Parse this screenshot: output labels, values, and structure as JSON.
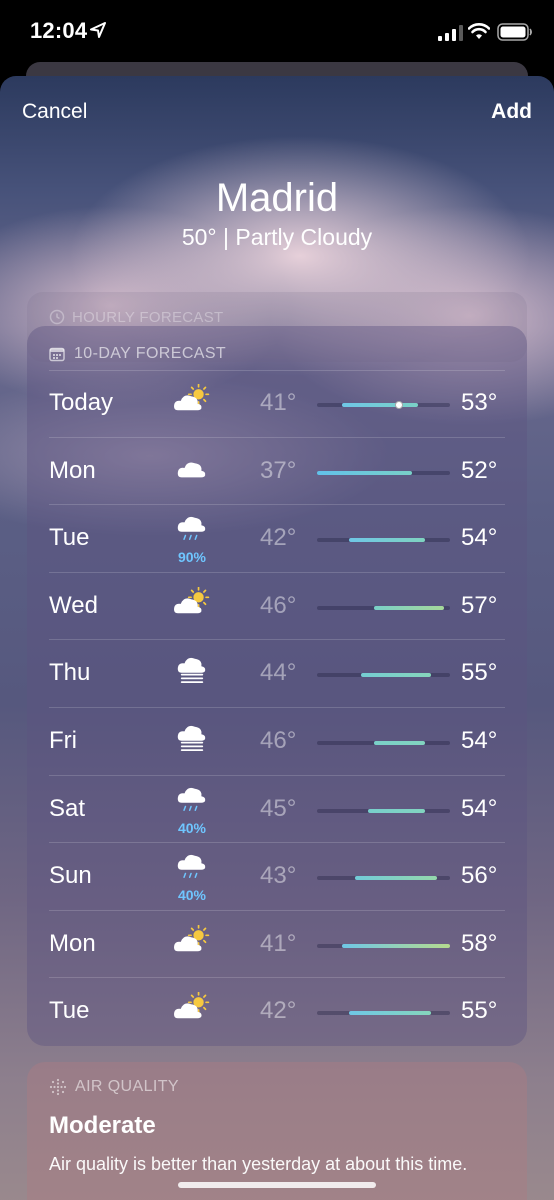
{
  "status_bar": {
    "time": "12:04"
  },
  "nav": {
    "cancel_label": "Cancel",
    "add_label": "Add"
  },
  "location": {
    "city": "Madrid",
    "current_summary": "50°  |  Partly Cloudy"
  },
  "hourly": {
    "label": "HOURLY FORECAST"
  },
  "forecast": {
    "label": "10-DAY FORECAST",
    "range_min": 37,
    "range_max": 58,
    "current_temp": 50,
    "days": [
      {
        "day": "Today",
        "icon": "partly-cloudy-icon",
        "precip": "",
        "low": "41°",
        "high": "53°",
        "low_val": 41,
        "high_val": 53,
        "current": true,
        "fill_from": "#6fc7e6",
        "fill_to": "#7ad1c6"
      },
      {
        "day": "Mon",
        "icon": "cloud-icon",
        "precip": "",
        "low": "37°",
        "high": "52°",
        "low_val": 37,
        "high_val": 52,
        "current": false,
        "fill_from": "#62c1ea",
        "fill_to": "#79d0c8"
      },
      {
        "day": "Tue",
        "icon": "rain-icon",
        "precip": "90%",
        "low": "42°",
        "high": "54°",
        "low_val": 42,
        "high_val": 54,
        "current": false,
        "fill_from": "#6fc7e6",
        "fill_to": "#7fd3c0"
      },
      {
        "day": "Wed",
        "icon": "partly-cloudy-icon",
        "precip": "",
        "low": "46°",
        "high": "57°",
        "low_val": 46,
        "high_val": 57,
        "current": false,
        "fill_from": "#7ad0c8",
        "fill_to": "#a6d89a"
      },
      {
        "day": "Thu",
        "icon": "fog-icon",
        "precip": "",
        "low": "44°",
        "high": "55°",
        "low_val": 44,
        "high_val": 55,
        "current": false,
        "fill_from": "#75cdd2",
        "fill_to": "#86d6bc"
      },
      {
        "day": "Fri",
        "icon": "fog-icon",
        "precip": "",
        "low": "46°",
        "high": "54°",
        "low_val": 46,
        "high_val": 54,
        "current": false,
        "fill_from": "#7ad0c8",
        "fill_to": "#82d4c0"
      },
      {
        "day": "Sat",
        "icon": "rain-icon",
        "precip": "40%",
        "low": "45°",
        "high": "54°",
        "low_val": 45,
        "high_val": 54,
        "current": false,
        "fill_from": "#78cfcc",
        "fill_to": "#82d4c0"
      },
      {
        "day": "Sun",
        "icon": "rain-icon",
        "precip": "40%",
        "low": "43°",
        "high": "56°",
        "low_val": 43,
        "high_val": 56,
        "current": false,
        "fill_from": "#72cbd8",
        "fill_to": "#94d8ac"
      },
      {
        "day": "Mon",
        "icon": "partly-cloudy-icon",
        "precip": "",
        "low": "41°",
        "high": "58°",
        "low_val": 41,
        "high_val": 58,
        "current": false,
        "fill_from": "#6fc7e6",
        "fill_to": "#b5db8e"
      },
      {
        "day": "Tue",
        "icon": "partly-cloudy-icon",
        "precip": "",
        "low": "42°",
        "high": "55°",
        "low_val": 42,
        "high_val": 55,
        "current": false,
        "fill_from": "#6fc7e6",
        "fill_to": "#86d6bc"
      }
    ]
  },
  "air_quality": {
    "label": "AIR QUALITY",
    "level": "Moderate",
    "description": "Air quality is better than yesterday at about this time."
  },
  "colors": {
    "precip": "#6fc6ff",
    "sun": "#f6c940"
  }
}
